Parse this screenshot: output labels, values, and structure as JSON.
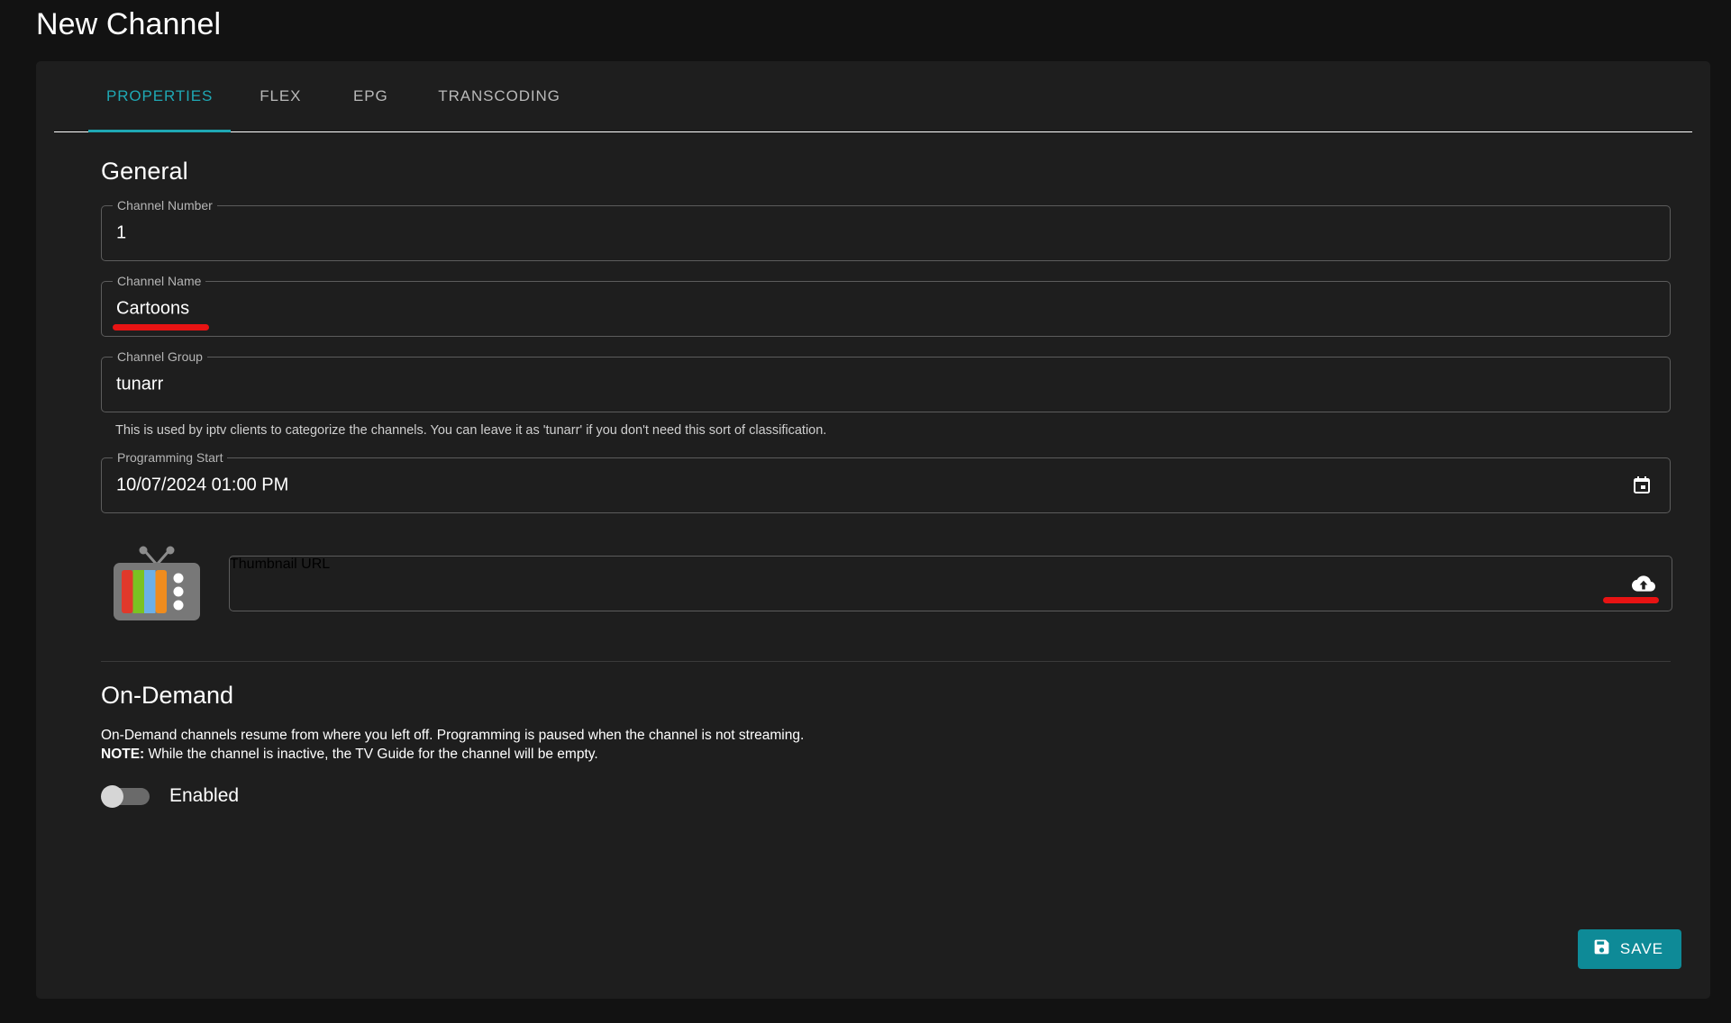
{
  "page": {
    "title": "New Channel"
  },
  "tabs": [
    {
      "label": "PROPERTIES",
      "active": true
    },
    {
      "label": "FLEX",
      "active": false
    },
    {
      "label": "EPG",
      "active": false
    },
    {
      "label": "TRANSCODING",
      "active": false
    }
  ],
  "general": {
    "section_title": "General",
    "channel_number": {
      "label": "Channel Number",
      "value": "1"
    },
    "channel_name": {
      "label": "Channel Name",
      "value": "Cartoons"
    },
    "channel_group": {
      "label": "Channel Group",
      "value": "tunarr",
      "helper": "This is used by iptv clients to categorize the channels. You can leave it as 'tunarr' if you don't need this sort of classification."
    },
    "programming_start": {
      "label": "Programming Start",
      "value": "10/07/2024 01:00 PM",
      "icon": "calendar-icon"
    },
    "thumbnail": {
      "placeholder": "Thumbnail URL",
      "value": "",
      "preview_icon": "tv-icon",
      "upload_icon": "cloud-upload-icon"
    }
  },
  "on_demand": {
    "title": "On-Demand",
    "description": "On-Demand channels resume from where you left off. Programming is paused when the channel is not streaming.",
    "note_label": "NOTE:",
    "note_text": " While the channel is inactive, the TV Guide for the channel will be empty.",
    "toggle_label": "Enabled",
    "toggle_state": "off"
  },
  "footer": {
    "save_label": "SAVE",
    "save_icon": "save-disk-icon"
  },
  "colors": {
    "accent": "#1fa8b4",
    "save_button": "#0e8a97",
    "annotation": "#e81313",
    "page_background": "#121212",
    "card_background": "#1e1e1e"
  },
  "annotations": [
    {
      "name": "channel-name-underline",
      "color": "#e81313"
    },
    {
      "name": "upload-icon-underline",
      "color": "#e81313"
    }
  ]
}
